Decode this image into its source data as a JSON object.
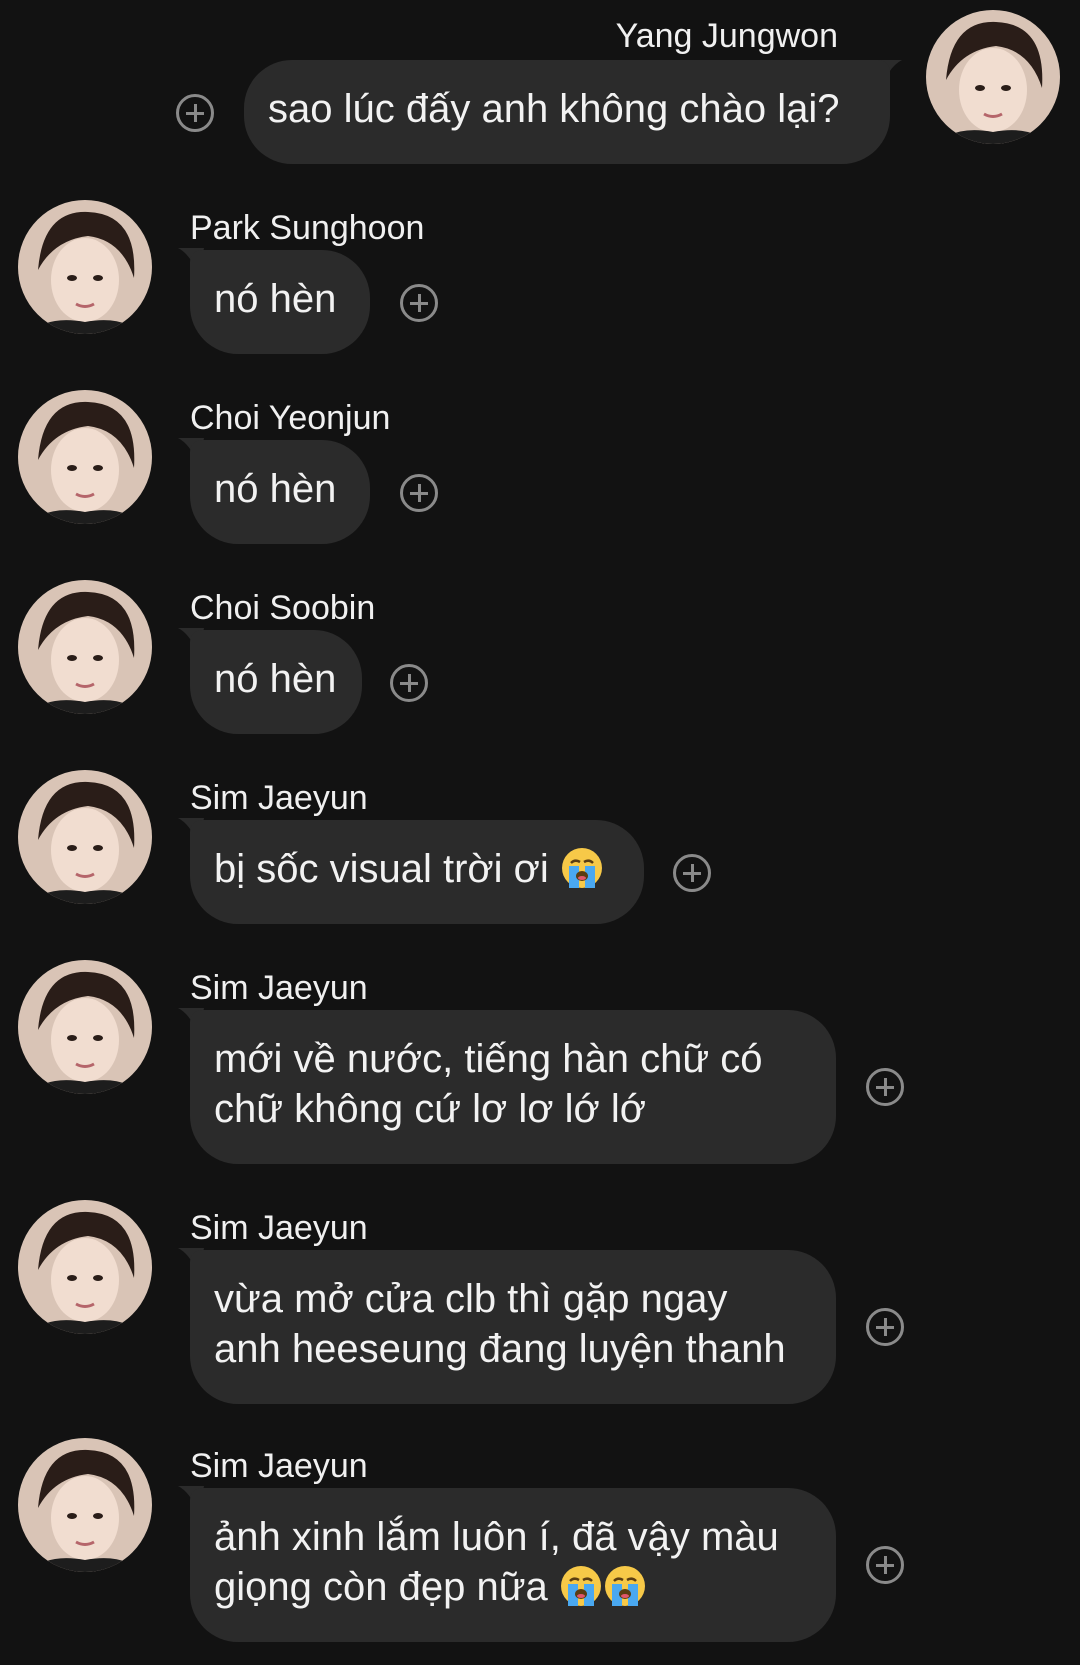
{
  "messages": [
    {
      "sender": "Yang Jungwon",
      "text": "sao lúc đấy anh không chào lại?",
      "side": "right",
      "avatar": "avatar-jungwon"
    },
    {
      "sender": "Park Sunghoon",
      "text": "nó hèn",
      "side": "left",
      "avatar": "avatar-sunghoon"
    },
    {
      "sender": "Choi Yeonjun",
      "text": "nó hèn",
      "side": "left",
      "avatar": "avatar-yeonjun"
    },
    {
      "sender": "Choi Soobin",
      "text": "nó hèn",
      "side": "left",
      "avatar": "avatar-soobin"
    },
    {
      "sender": "Sim Jaeyun",
      "text": "bị sốc visual trời ơi",
      "emoji": "loudly-crying-face",
      "side": "left",
      "avatar": "avatar-jaeyun"
    },
    {
      "sender": "Sim Jaeyun",
      "lines": [
        "mới về nước, tiếng hàn chữ có",
        "chữ không cứ lơ lơ lớ lớ"
      ],
      "side": "left",
      "avatar": "avatar-jaeyun"
    },
    {
      "sender": "Sim Jaeyun",
      "lines": [
        "vừa mở cửa clb thì gặp ngay",
        "anh heeseung đang luyện thanh"
      ],
      "side": "left",
      "avatar": "avatar-jaeyun"
    },
    {
      "sender": "Sim Jaeyun",
      "lines": [
        "ảnh xinh lắm luôn í, đã vậy màu",
        "giọng còn đẹp nữa"
      ],
      "emoji_count": 2,
      "emoji": "loudly-crying-face",
      "side": "left",
      "avatar": "avatar-jaeyun"
    }
  ],
  "reaction_icon": "add-reaction-icon",
  "colors": {
    "background": "#121212",
    "bubble": "#2b2b2b",
    "text": "#f2f2f2",
    "icon": "#8a8a8a"
  }
}
